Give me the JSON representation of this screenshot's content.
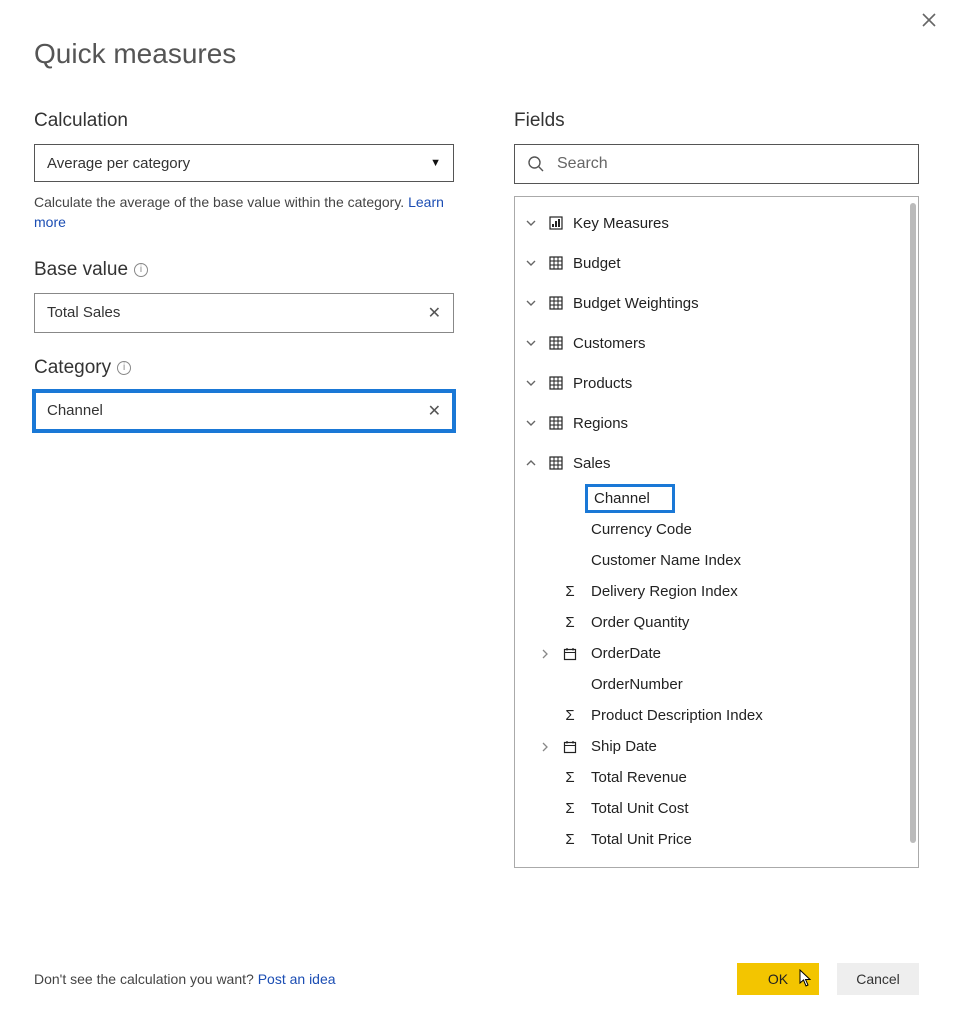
{
  "dialog": {
    "title": "Quick measures",
    "close_aria": "Close"
  },
  "calc": {
    "label": "Calculation",
    "selected": "Average per category",
    "help_prefix": "Calculate the average of the base value within the category. ",
    "learn_more": "Learn more"
  },
  "base_value": {
    "label": "Base value",
    "value": "Total Sales"
  },
  "category": {
    "label": "Category",
    "value": "Channel"
  },
  "fields": {
    "label": "Fields",
    "search_placeholder": "Search",
    "tables": [
      {
        "name": "Key Measures",
        "icon": "measures",
        "expanded": false
      },
      {
        "name": "Budget",
        "icon": "table",
        "expanded": false
      },
      {
        "name": "Budget Weightings",
        "icon": "table",
        "expanded": false
      },
      {
        "name": "Customers",
        "icon": "table",
        "expanded": false
      },
      {
        "name": "Products",
        "icon": "table",
        "expanded": false
      },
      {
        "name": "Regions",
        "icon": "table",
        "expanded": false
      },
      {
        "name": "Sales",
        "icon": "table",
        "expanded": true
      }
    ],
    "sales_columns": [
      {
        "name": "Channel",
        "icon": "none",
        "highlight": true
      },
      {
        "name": "Currency Code",
        "icon": "none"
      },
      {
        "name": "Customer Name Index",
        "icon": "none"
      },
      {
        "name": "Delivery Region Index",
        "icon": "sigma"
      },
      {
        "name": "Order Quantity",
        "icon": "sigma"
      },
      {
        "name": "OrderDate",
        "icon": "date",
        "expandable": true
      },
      {
        "name": "OrderNumber",
        "icon": "none"
      },
      {
        "name": "Product Description Index",
        "icon": "sigma"
      },
      {
        "name": "Ship Date",
        "icon": "date",
        "expandable": true
      },
      {
        "name": "Total Revenue",
        "icon": "sigma"
      },
      {
        "name": "Total Unit Cost",
        "icon": "sigma"
      },
      {
        "name": "Total Unit Price",
        "icon": "sigma"
      }
    ]
  },
  "footer": {
    "prompt": "Don't see the calculation you want? ",
    "link": "Post an idea",
    "ok": "OK",
    "cancel": "Cancel"
  }
}
